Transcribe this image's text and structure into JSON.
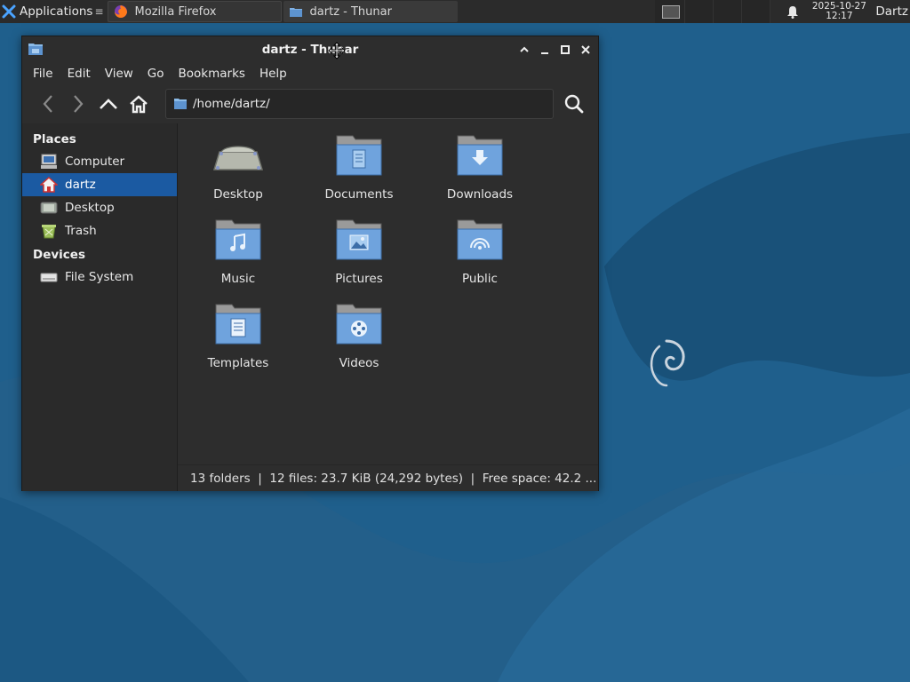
{
  "panel": {
    "applications_label": "Applications",
    "applications_arrow": "≡",
    "tasks": [
      {
        "label": "Mozilla Firefox",
        "icon": "firefox-icon"
      },
      {
        "label": "dartz - Thunar",
        "icon": "folder-icon"
      }
    ],
    "clock_date": "2025-10-27",
    "clock_time": "12:17",
    "user": "Dartz"
  },
  "window": {
    "title": "dartz - Thunar",
    "menu": [
      "File",
      "Edit",
      "View",
      "Go",
      "Bookmarks",
      "Help"
    ],
    "location": "/home/dartz/",
    "sidebar": {
      "places_heading": "Places",
      "places": [
        {
          "label": "Computer",
          "icon": "computer-icon"
        },
        {
          "label": "dartz",
          "icon": "home-icon",
          "selected": true
        },
        {
          "label": "Desktop",
          "icon": "desktop-icon"
        },
        {
          "label": "Trash",
          "icon": "trash-icon"
        }
      ],
      "devices_heading": "Devices",
      "devices": [
        {
          "label": "File System",
          "icon": "drive-icon"
        }
      ]
    },
    "files": [
      {
        "label": "Desktop",
        "icon": "desktop-folder-icon"
      },
      {
        "label": "Documents",
        "icon": "documents-folder-icon"
      },
      {
        "label": "Downloads",
        "icon": "downloads-folder-icon"
      },
      {
        "label": "Music",
        "icon": "music-folder-icon"
      },
      {
        "label": "Pictures",
        "icon": "pictures-folder-icon"
      },
      {
        "label": "Public",
        "icon": "public-folder-icon"
      },
      {
        "label": "Templates",
        "icon": "templates-folder-icon"
      },
      {
        "label": "Videos",
        "icon": "videos-folder-icon"
      }
    ],
    "status": "13 folders  |  12 files: 23.7 KiB (24,292 bytes)  |  Free space: 42.2 ..."
  },
  "colors": {
    "accent": "#1b5aa2",
    "folder": "#6a9fd8",
    "desktop_bg": "#1d5a86"
  }
}
